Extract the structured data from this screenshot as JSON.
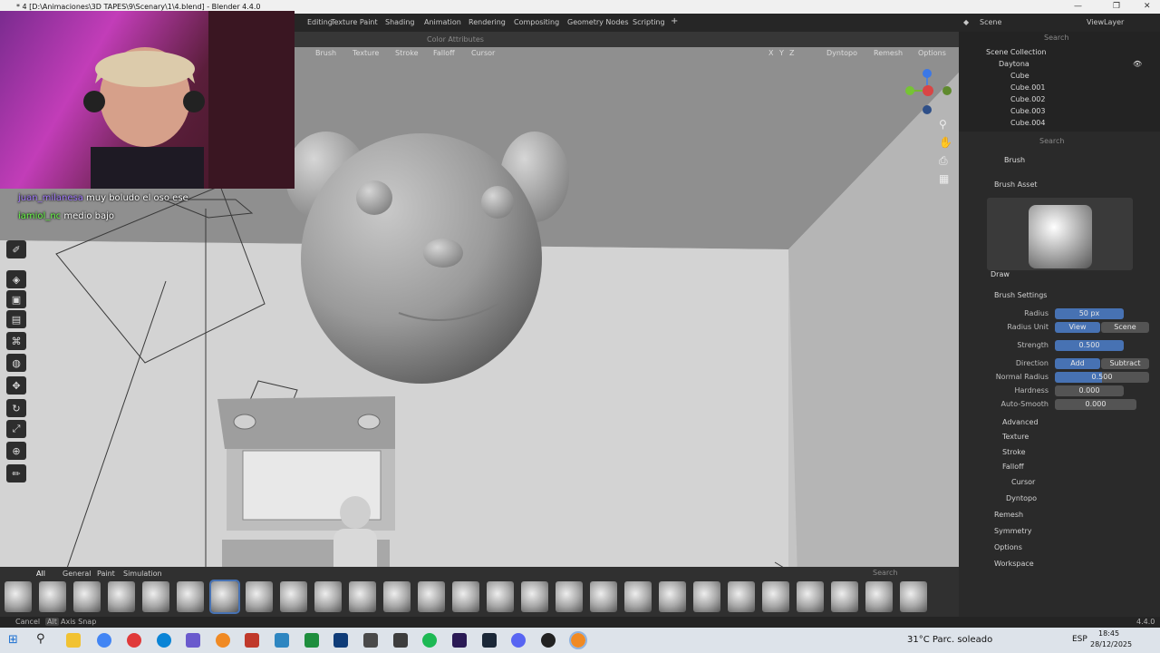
{
  "window": {
    "title": "* 4 [D:\\Animaciones\\3D TAPES\\9\\Scenary\\1\\4.blend] - Blender 4.4.0",
    "min": "—",
    "max": "❐",
    "close": "✕"
  },
  "workspace_tabs": [
    "Editing",
    "Texture Paint",
    "Shading",
    "Animation",
    "Rendering",
    "Compositing",
    "Geometry Nodes",
    "Scripting",
    "+"
  ],
  "scene": {
    "label": "Scene",
    "viewlayer": "ViewLayer"
  },
  "viewport_header": {
    "color_attributes": "Color Attributes",
    "menus": [
      "Brush",
      "Texture",
      "Stroke",
      "Falloff",
      "Cursor"
    ],
    "axes": [
      "X",
      "Y",
      "Z"
    ],
    "dyntopo": "Dyntopo",
    "remesh": "Remesh",
    "options": "Options"
  },
  "chat": [
    {
      "user": "juan_milanesa",
      "text": "muy boludo el oso ese"
    },
    {
      "user": "iamiol_nc",
      "text": "medio bajo"
    }
  ],
  "outliner": {
    "search_placeholder": "Search",
    "root": "Scene Collection",
    "collection": "Daytona",
    "items": [
      "Cube",
      "Cube.001",
      "Cube.002",
      "Cube.003",
      "Cube.004"
    ]
  },
  "properties": {
    "search_placeholder": "Search",
    "header": "Brush",
    "brush_asset_label": "Brush Asset",
    "brush_name": "Draw",
    "brush_settings_label": "Brush Settings",
    "radius_label": "Radius",
    "radius_value": "50 px",
    "radius_unit_label": "Radius Unit",
    "radius_unit_view": "View",
    "radius_unit_scene": "Scene",
    "strength_label": "Strength",
    "strength_value": "0.500",
    "direction_label": "Direction",
    "direction_add": "Add",
    "direction_subtract": "Subtract",
    "normal_radius_label": "Normal Radius",
    "normal_radius_value": "0.500",
    "hardness_label": "Hardness",
    "hardness_value": "0.000",
    "autosmooth_label": "Auto-Smooth",
    "autosmooth_value": "0.000",
    "subsections": [
      "Advanced",
      "Texture",
      "Stroke",
      "Falloff",
      "Cursor"
    ],
    "sections": [
      "Dyntopo",
      "Remesh",
      "Symmetry",
      "Options",
      "Workspace"
    ]
  },
  "asset_shelf": {
    "tabs": [
      "All",
      "General",
      "Paint",
      "Simulation"
    ],
    "search_placeholder": "Search"
  },
  "statusbar": {
    "cancel": "Cancel",
    "alt": "Alt",
    "axis_snap": "Axis Snap",
    "version": "4.4.0"
  },
  "taskbar": {
    "weather": "31°C  Parc. soleado",
    "lang": "ESP",
    "time": "18:45",
    "date": "28/12/2025"
  }
}
